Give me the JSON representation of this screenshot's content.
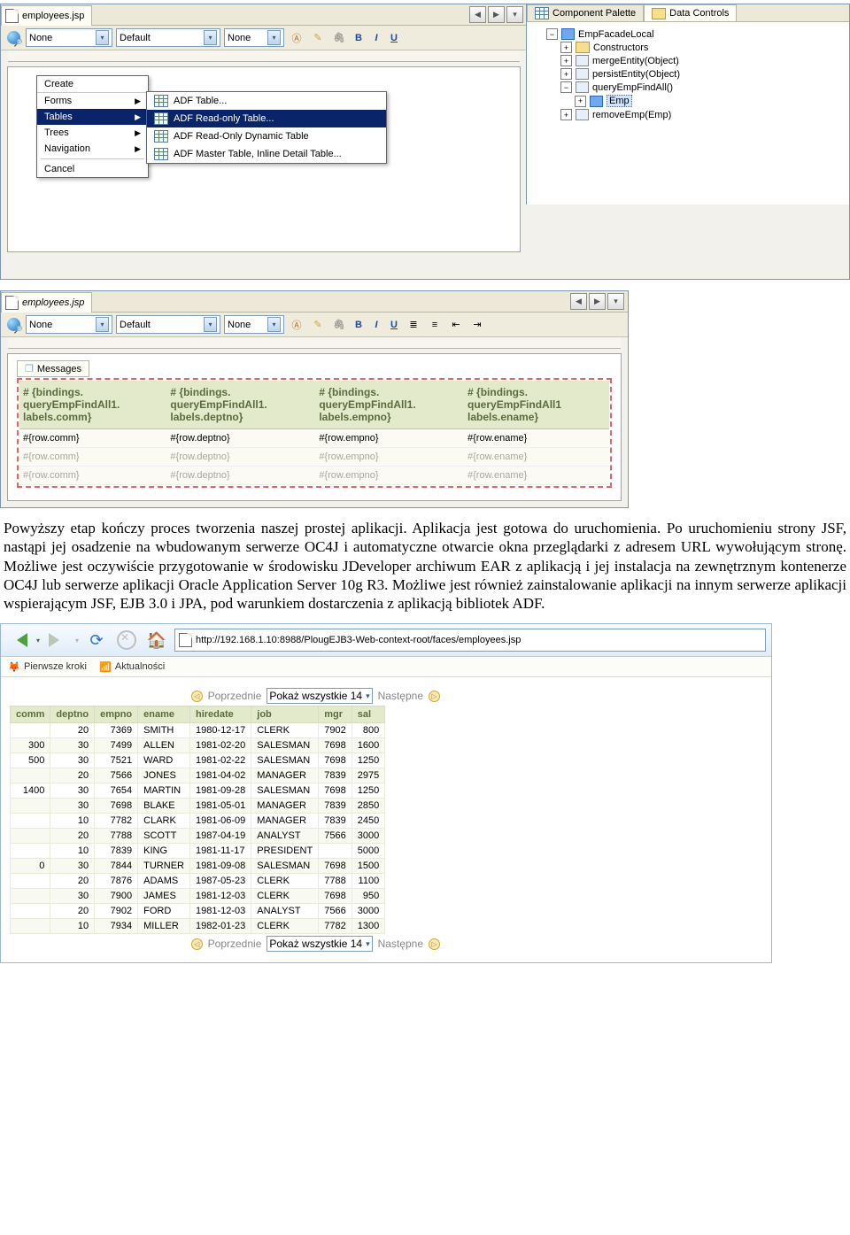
{
  "ide1": {
    "tab": "employees.jsp",
    "dd_style": "None",
    "dd_font": "Default",
    "dd_size": "None",
    "ctx_title": "Create",
    "ctx_items": [
      "Forms",
      "Tables",
      "Trees",
      "Navigation"
    ],
    "ctx_cancel": "Cancel",
    "sub": [
      "ADF Table...",
      "ADF Read-only Table...",
      "ADF Read-Only Dynamic Table",
      "ADF Master Table, Inline Detail Table..."
    ],
    "pal_tab1": "Component Palette",
    "pal_tab2": "Data Controls",
    "tree": {
      "root": "EmpFacadeLocal",
      "c1": "Constructors",
      "c2": "mergeEntity(Object)",
      "c3": "persistEntity(Object)",
      "c4": "queryEmpFindAll()",
      "c4a": "Emp",
      "c5": "removeEmp(Emp)"
    }
  },
  "ide2": {
    "tab": "employees.jsp",
    "dd_style": "None",
    "dd_font": "Default",
    "dd_size": "None",
    "msg": "Messages",
    "head": {
      "a": "# {bindings. queryEmpFindAll1. labels.comm}",
      "b": "# {bindings. queryEmpFindAll1. labels.deptno}",
      "c": "# {bindings. queryEmpFindAll1. labels.empno}",
      "d": "# {bindings. queryEmpFindAll1 labels.ename}"
    },
    "row": {
      "a": "#{row.comm}",
      "b": "#{row.deptno}",
      "c": "#{row.empno}",
      "d": "#{row.ename}"
    }
  },
  "para": "Powyższy etap kończy proces tworzenia naszej prostej aplikacji. Aplikacja jest gotowa do uruchomienia. Po uruchomieniu strony JSF, nastąpi jej osadzenie na wbudowanym serwerze OC4J i automatyczne otwarcie okna przeglądarki z adresem URL wywołującym stronę. Możliwe jest oczywiście przygotowanie w środowisku JDeveloper archiwum EAR z aplikacją i jej instalacja na zewnętrznym kontenerze OC4J lub serwerze aplikacji Oracle Application Server 10g R3. Możliwe jest również zainstalowanie aplikacji na innym serwerze aplikacji wspierającym JSF, EJB 3.0 i JPA, pod warunkiem dostarczenia z aplikacją bibliotek ADF.",
  "browser": {
    "url": "http://192.168.1.10:8988/PlougEJB3-Web-context-root/faces/employees.jsp",
    "bm1": "Pierwsze kroki",
    "bm2": "Aktualności",
    "pager_prev": "Poprzednie",
    "pager_sel": "Pokaż wszystkie 14",
    "pager_next": "Następne",
    "cols": [
      "comm",
      "deptno",
      "empno",
      "ename",
      "hiredate",
      "job",
      "mgr",
      "sal"
    ],
    "rows": [
      [
        "",
        "20",
        "7369",
        "SMITH",
        "1980-12-17",
        "CLERK",
        "7902",
        "800"
      ],
      [
        "300",
        "30",
        "7499",
        "ALLEN",
        "1981-02-20",
        "SALESMAN",
        "7698",
        "1600"
      ],
      [
        "500",
        "30",
        "7521",
        "WARD",
        "1981-02-22",
        "SALESMAN",
        "7698",
        "1250"
      ],
      [
        "",
        "20",
        "7566",
        "JONES",
        "1981-04-02",
        "MANAGER",
        "7839",
        "2975"
      ],
      [
        "1400",
        "30",
        "7654",
        "MARTIN",
        "1981-09-28",
        "SALESMAN",
        "7698",
        "1250"
      ],
      [
        "",
        "30",
        "7698",
        "BLAKE",
        "1981-05-01",
        "MANAGER",
        "7839",
        "2850"
      ],
      [
        "",
        "10",
        "7782",
        "CLARK",
        "1981-06-09",
        "MANAGER",
        "7839",
        "2450"
      ],
      [
        "",
        "20",
        "7788",
        "SCOTT",
        "1987-04-19",
        "ANALYST",
        "7566",
        "3000"
      ],
      [
        "",
        "10",
        "7839",
        "KING",
        "1981-11-17",
        "PRESIDENT",
        "",
        "5000"
      ],
      [
        "0",
        "30",
        "7844",
        "TURNER",
        "1981-09-08",
        "SALESMAN",
        "7698",
        "1500"
      ],
      [
        "",
        "20",
        "7876",
        "ADAMS",
        "1987-05-23",
        "CLERK",
        "7788",
        "1100"
      ],
      [
        "",
        "30",
        "7900",
        "JAMES",
        "1981-12-03",
        "CLERK",
        "7698",
        "950"
      ],
      [
        "",
        "20",
        "7902",
        "FORD",
        "1981-12-03",
        "ANALYST",
        "7566",
        "3000"
      ],
      [
        "",
        "10",
        "7934",
        "MILLER",
        "1982-01-23",
        "CLERK",
        "7782",
        "1300"
      ]
    ]
  }
}
